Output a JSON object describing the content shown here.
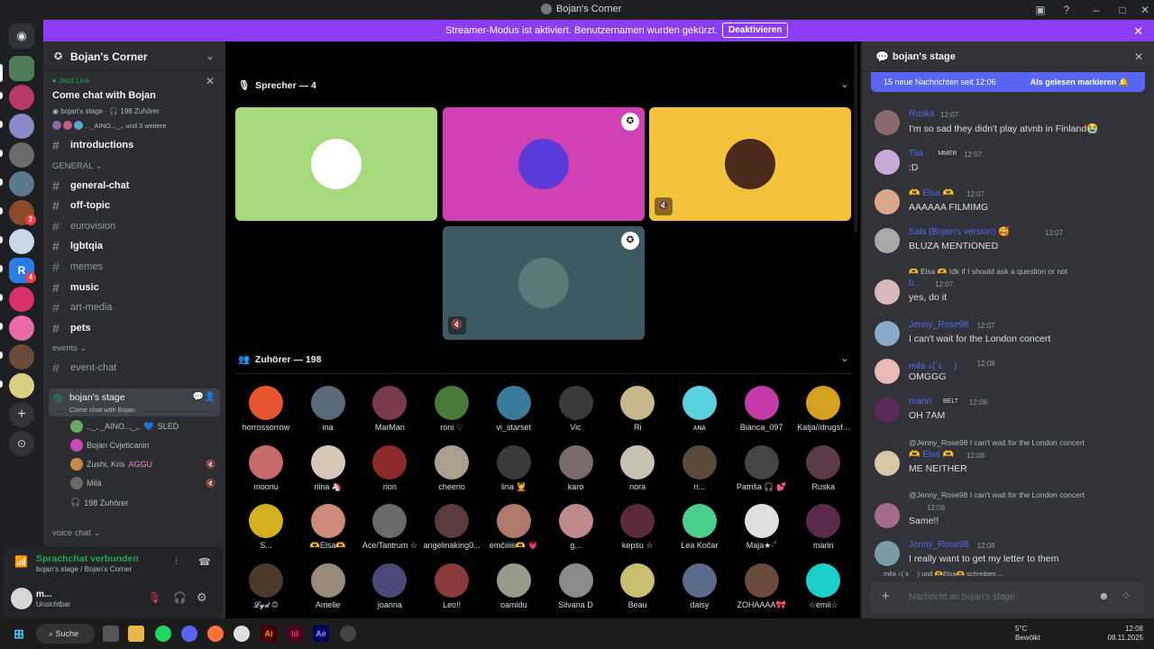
{
  "window": {
    "title": "Bojan's Corner"
  },
  "banner": {
    "text": "Streamer-Modus ist aktiviert. Benutzernamen wurden gekürzt.",
    "button": "Deaktivieren"
  },
  "server": {
    "name": "Bojan's Corner"
  },
  "live": {
    "badge": "Jetzt Live",
    "title": "Come chat with Bojan",
    "stage": "bojan's stage",
    "listeners": "198 Zuhörer",
    "others": "und 3 weitere"
  },
  "channels": [
    {
      "name": "introductions",
      "bold": true
    },
    {
      "category": "GENERAL"
    },
    {
      "name": "general-chat",
      "bold": true
    },
    {
      "name": "off-topic",
      "bold": true
    },
    {
      "name": "eurovision",
      "bold": false
    },
    {
      "name": "lgbtqia",
      "bold": true
    },
    {
      "name": "memes",
      "bold": false
    },
    {
      "name": "music",
      "bold": true
    },
    {
      "name": "art-media",
      "bold": false
    },
    {
      "name": "pets",
      "bold": true
    },
    {
      "category": "events"
    },
    {
      "name": "event-chat",
      "bold": false
    }
  ],
  "active_stage": {
    "name": "bojan's stage",
    "topic": "Come chat with Bojan",
    "members": [
      "SLED",
      "Bojan Cvjeticanin",
      "Zushi, Kris",
      "Milà"
    ],
    "tags": [
      "",
      "",
      "AGGU",
      ""
    ],
    "listeners": "198 Zuhörer"
  },
  "voice_category": "voice chat",
  "voice": {
    "status": "Sprachchat verbunden",
    "where": "bojan's stage / Bojan's Corner"
  },
  "user": {
    "name": "m...",
    "status": "Unsichtbar"
  },
  "stage": {
    "speakers_label": "Sprecher — 4",
    "listeners_label": "Zuhörer — 198"
  },
  "speakers": [
    {
      "color": "#a6d97c"
    },
    {
      "color": "#d140b5"
    },
    {
      "color": "#f5c23c"
    },
    {
      "color": "#3d5a63"
    }
  ],
  "listeners": [
    "horrossorrow",
    "ina",
    "MarMari",
    "roni ♡",
    "vi_starset",
    "Vic",
    "Ri",
    "ᴀɴᴀ",
    "Bianca_097",
    "Katja//drugsf...",
    "moonu",
    "riina 🦄",
    "rion",
    "cheerio",
    "lina 💆",
    "karo",
    "nora",
    "n...",
    "Patriša 🎧 💕",
    "Ruska",
    "S...",
    "🫶Elsa🫶",
    "Ace/Tantrum ☆",
    "angelinaking0...",
    "emčiiiiii🫶 💗",
    "g...",
    "kepsu ☆",
    "Lea Kočar",
    "Maja★·˚",
    "marin",
    "𝓛𝔂𝓭 ◎",
    "Amelie",
    "joanna",
    "Leo!!",
    "oamidu",
    "Silvana D",
    "Beau",
    "daisy",
    "ZOHAAAA🎀",
    "☆emii☆"
  ],
  "listener_colors": [
    "#e5542e",
    "#5a6a7a",
    "#7a3a4a",
    "#4a7a3a",
    "#3a7a9a",
    "#3a3a3a",
    "#c9b98a",
    "#5ad0e0",
    "#c43aa8",
    "#d4a020",
    "#c76a6a",
    "#d8c8b8",
    "#8a2a2a",
    "#aaa090",
    "#3a3a3a",
    "#7a6a6a",
    "#c8c0b0",
    "#5a4a3a",
    "#444",
    "#5a3a4a",
    "#d4b020",
    "#d08a7a",
    "#6a6a6a",
    "#5a3a3a",
    "#b07a6a",
    "#c08a8a",
    "#5a2a3a",
    "#4ad08a",
    "#e0e0e0",
    "#5a2a4a",
    "#4a3a2a",
    "#9a8a7a",
    "#4a4a7a",
    "#8a3a3a",
    "#9a9a8a",
    "#8a8a8a",
    "#c8c070",
    "#5a6a8a",
    "#6a4a3a",
    "#1ad0c8"
  ],
  "chat": {
    "channel": "bojan's stage",
    "new_bar": "15 neue Nachrichten seit 12:06",
    "mark_read": "Als gelesen markieren",
    "messages": [
      {
        "name": "Ruska",
        "time": "12:07",
        "text": "I'm so sad they didn't play atvnb in Finland😭",
        "color": "#5865f2"
      },
      {
        "name": "Tiia",
        "tag": "MMER",
        "time": "12:07",
        "text": ":D",
        "color": "#5865f2"
      },
      {
        "name": "🫶 Elsa 🫶",
        "time": "12:07",
        "text": "AAAAAA FILMIMG",
        "color": "#5865f2"
      },
      {
        "name": "Sals (Bojan's version) 🥰",
        "time": "12:07",
        "text": "BLUZA MENTIONED",
        "color": "#5865f2"
      },
      {
        "reply": "🫶 Elsa 🫶 Idk if I should ask a question or not",
        "name": "b...",
        "time": "12:07",
        "text": "yes, do it",
        "color": "#5865f2"
      },
      {
        "name": "Jenny_Rose98",
        "time": "12:07",
        "text": "I can't wait for the London concert",
        "color": "#5865f2"
      },
      {
        "name": "mila ♪(´ε｀ )",
        "time": "12:08",
        "text": "OMGGG",
        "color": "#5865f2"
      },
      {
        "name": "marin",
        "tag": "BELT",
        "time": "12:08",
        "text": "OH 7AM",
        "color": "#5865f2"
      },
      {
        "reply": "@Jenny_Rose98 I can't wait for the London concert",
        "name": "🫶 Elsa 🫶",
        "time": "12:08",
        "text": "ME NEITHER",
        "color": "#5865f2"
      },
      {
        "reply": "@Jenny_Rose98 I can't wait for the London concert",
        "name": "",
        "time": "12:08",
        "text": "Same!!",
        "color": "#5865f2"
      },
      {
        "name": "Jenny_Rose98",
        "time": "12:08",
        "text": "I really want to get my letter to them",
        "color": "#5865f2"
      }
    ],
    "typing": "mila ♪(´ε｀ ) und 🫶Elsa🫶 schreiben ...",
    "input_placeholder": "Nachricht an bojan's stage"
  },
  "taskbar": {
    "search": "Suche",
    "weather_temp": "5°C",
    "weather": "Bewölkt",
    "time": "12:08",
    "date": "08.11.2025"
  }
}
